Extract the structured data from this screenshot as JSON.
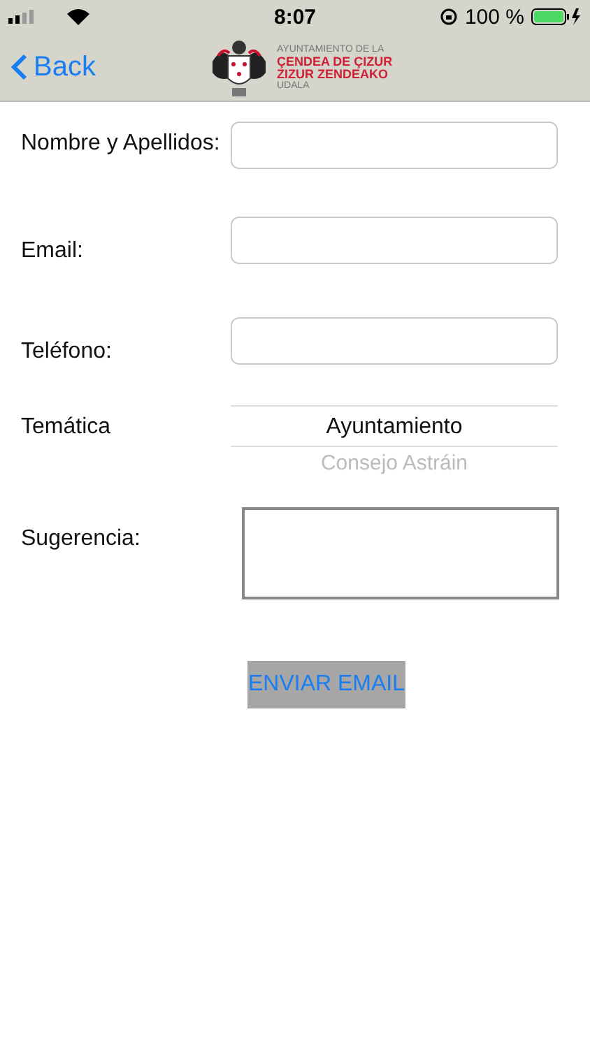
{
  "status_bar": {
    "time": "8:07",
    "battery": "100 %"
  },
  "nav_bar": {
    "back": "Back",
    "logo": {
      "line_1": "AYUNTAMIENTO DE LA",
      "line_2": "ÇENDEA DE ÇIZUR",
      "line_3": "ZIZUR ZENDEAKO",
      "line_4": "UDALA"
    }
  },
  "form": {
    "fields": [
      {
        "kind": "text",
        "label": "Nombre y Apellidos:"
      },
      {
        "kind": "text",
        "label": "Email:"
      },
      {
        "kind": "text",
        "label": "Teléfono:"
      },
      {
        "kind": "picker",
        "label": "Temática",
        "options": [
          {
            "label": "Ayuntamiento",
            "selected": true
          },
          {
            "label": "Consejo Astráin",
            "selected": false
          }
        ]
      },
      {
        "kind": "textarea",
        "label": "Sugerencia:"
      }
    ],
    "submit": "ENVIAR EMAIL"
  }
}
